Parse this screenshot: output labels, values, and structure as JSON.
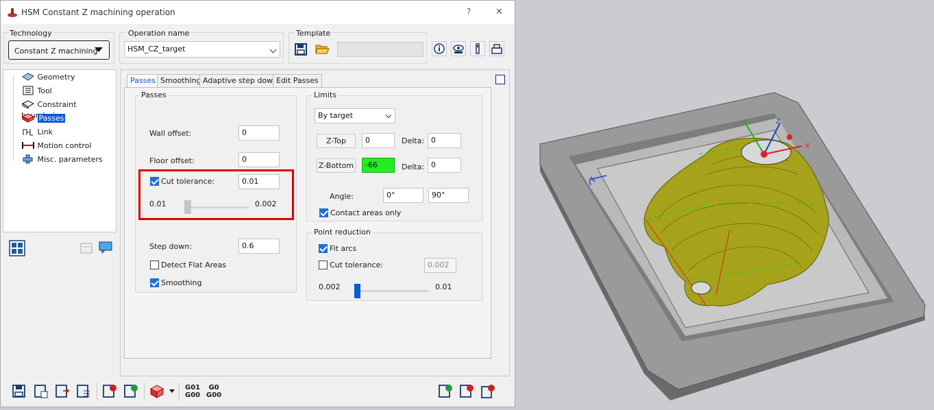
{
  "window": {
    "title": "HSM Constant Z machining operation",
    "help": "?",
    "close": "✕"
  },
  "technology": {
    "label": "Technology",
    "value": "Constant Z machining"
  },
  "operation": {
    "label": "Operation name",
    "value": "HSM_CZ_target"
  },
  "template": {
    "label": "Template"
  },
  "tree": {
    "items": [
      "Geometry",
      "Tool",
      "Constraint boundaries",
      "Passes",
      "Link",
      "Motion control",
      "Misc. parameters"
    ]
  },
  "tabs": [
    "Passes",
    "Smoothing",
    "Adaptive step down",
    "Edit Passes"
  ],
  "passes": {
    "group_label": "Passes",
    "wall_offset_label": "Wall offset:",
    "wall_offset": "0",
    "floor_offset_label": "Floor offset:",
    "floor_offset": "0",
    "cut_tol_label": "Cut tolerance:",
    "cut_tol": "0.01",
    "slider_min": "0.01",
    "slider_max": "0.002",
    "step_down_label": "Step down:",
    "step_down": "0.6",
    "detect_flat_label": "Detect Flat Areas",
    "smoothing_label": "Smoothing"
  },
  "limits": {
    "group_label": "Limits",
    "mode": "By target",
    "ztop_btn": "Z-Top",
    "ztop": "0",
    "delta_label": "Delta:",
    "ztop_delta": "0",
    "zbottom_btn": "Z-Bottom",
    "zbottom": "-66",
    "zbottom_delta": "0",
    "angle_label": "Angle:",
    "angle_from": "0°",
    "angle_to": "90°",
    "contact_label": "Contact areas only",
    "highlight_color": "#22ee22"
  },
  "point_reduction": {
    "group_label": "Point reduction",
    "fit_arcs_label": "Fit arcs",
    "cut_tol_label": "Cut tolerance:",
    "cut_tol": "0.002",
    "slider_min": "0.002",
    "slider_max": "0.01"
  },
  "bottom_toolbar": {
    "g01": "G01",
    "g00a": "G00",
    "g0b": "G0",
    "g00b": "G00"
  },
  "viewport": {
    "axis_x": "X",
    "axis_z": "Z",
    "part_color": "#a6a31a",
    "stock_color": "#9a9a9a"
  },
  "colors": {
    "accent": "#0b5cd5",
    "highlight_frame": "#e00000"
  }
}
